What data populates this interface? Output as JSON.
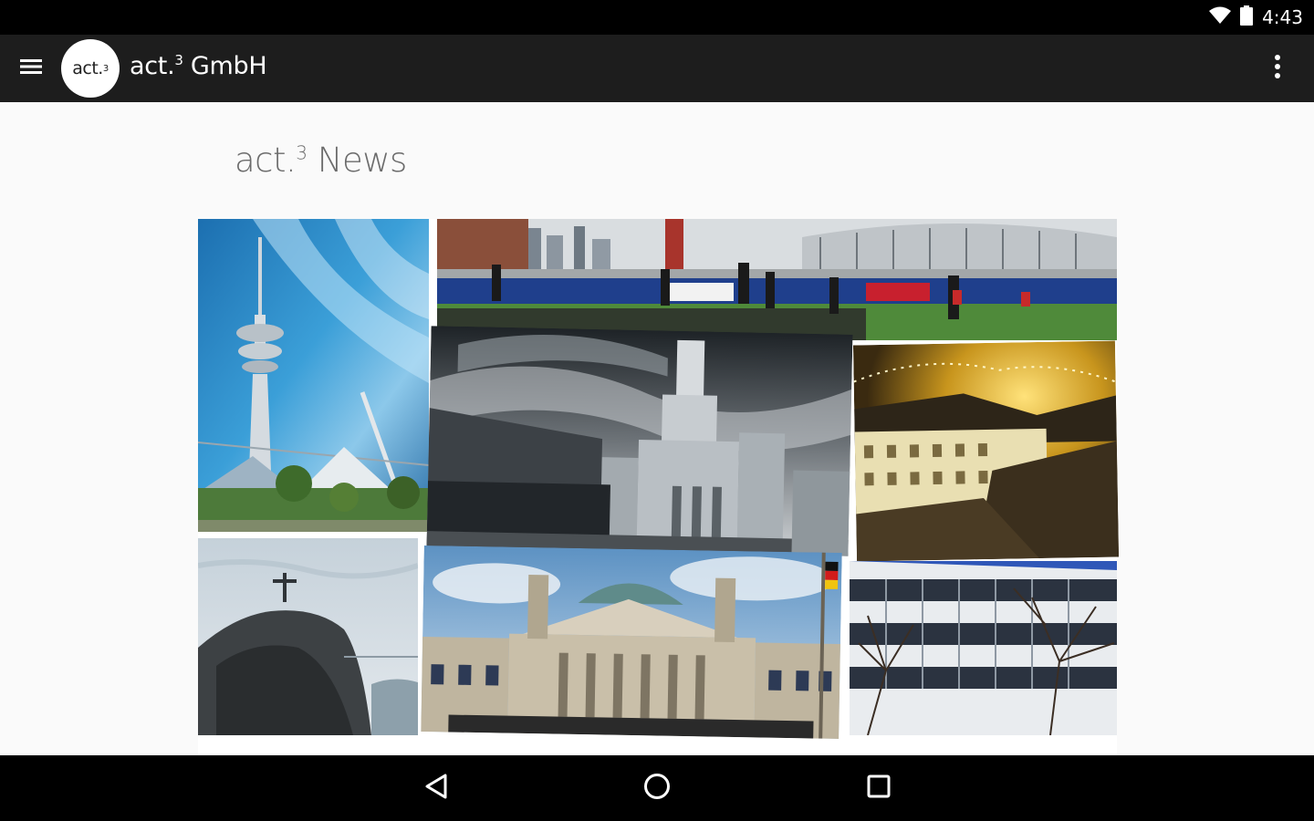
{
  "status_bar": {
    "time": "4:43",
    "icons": [
      "wifi-icon",
      "battery-icon"
    ]
  },
  "app_bar": {
    "logo_text": "act.",
    "logo_superscript": "3",
    "title": "act.",
    "title_superscript": "3",
    "title_suffix": " GmbH",
    "menu_icon": "hamburger-menu-icon",
    "overflow_icon": "overflow-menu-icon"
  },
  "page": {
    "title": "act.",
    "title_superscript": "3",
    "title_suffix": " News"
  },
  "gallery": [
    {
      "name": "munich-tv-tower-photo"
    },
    {
      "name": "london-stadium-football-photo"
    },
    {
      "name": "warsaw-palace-of-culture-photo"
    },
    {
      "name": "city-rooftops-night-photo"
    },
    {
      "name": "rio-christ-statue-photo"
    },
    {
      "name": "berlin-reichstag-photo"
    },
    {
      "name": "office-building-photo"
    }
  ],
  "nav_bar": {
    "icons": [
      "back-icon",
      "home-icon",
      "recents-icon"
    ]
  },
  "colors": {
    "status_bar": "#000000",
    "app_bar": "#1d1d1d",
    "content_bg": "#fafafa",
    "title_text": "#6b6b6b"
  }
}
